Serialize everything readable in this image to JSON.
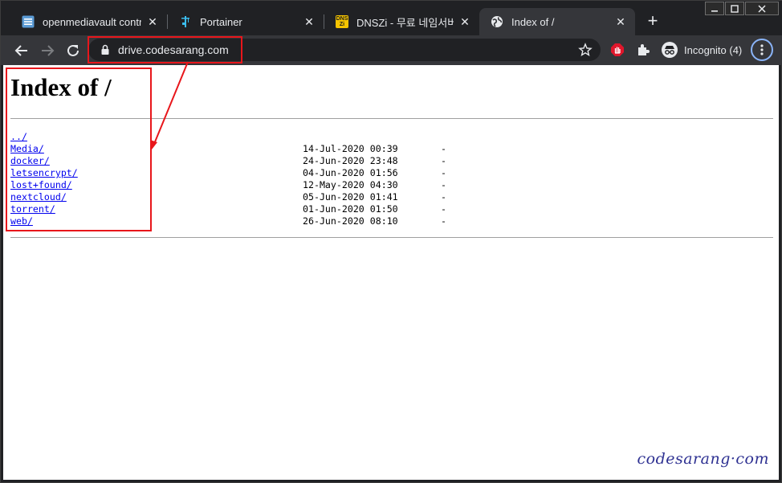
{
  "tabs": [
    {
      "title": "openmediavault control",
      "icon": "list-icon",
      "active": false
    },
    {
      "title": "Portainer",
      "icon": "portainer-crane-icon",
      "active": false
    },
    {
      "title": "DNSZi - 무료 네임서버(d",
      "icon": "dnszi-icon",
      "active": false
    },
    {
      "title": "Index of /",
      "icon": "globe-icon",
      "active": true
    }
  ],
  "tab_icon_texts": {
    "dnszi_top": "DNS",
    "dnszi_bottom": "Zi"
  },
  "address_bar": {
    "url": "drive.codesarang.com"
  },
  "profile": {
    "label": "Incognito (4)"
  },
  "page": {
    "heading": "Index of /",
    "parent_link": "../",
    "entries": [
      {
        "name": "Media/",
        "date": "14-Jul-2020 00:39",
        "size": "-"
      },
      {
        "name": "docker/",
        "date": "24-Jun-2020 23:48",
        "size": "-"
      },
      {
        "name": "letsencrypt/",
        "date": "04-Jun-2020 01:56",
        "size": "-"
      },
      {
        "name": "lost+found/",
        "date": "12-May-2020 04:30",
        "size": "-"
      },
      {
        "name": "nextcloud/",
        "date": "05-Jun-2020 01:41",
        "size": "-"
      },
      {
        "name": "torrent/",
        "date": "01-Jun-2020 01:50",
        "size": "-"
      },
      {
        "name": "web/",
        "date": "26-Jun-2020 08:10",
        "size": "-"
      }
    ]
  },
  "watermark": "codesarang·com",
  "colors": {
    "link": "#0000ee",
    "annotation": "#e8161b",
    "chrome_dark": "#202124",
    "chrome_toolbar": "#35363a",
    "watermark": "#2e3192"
  }
}
